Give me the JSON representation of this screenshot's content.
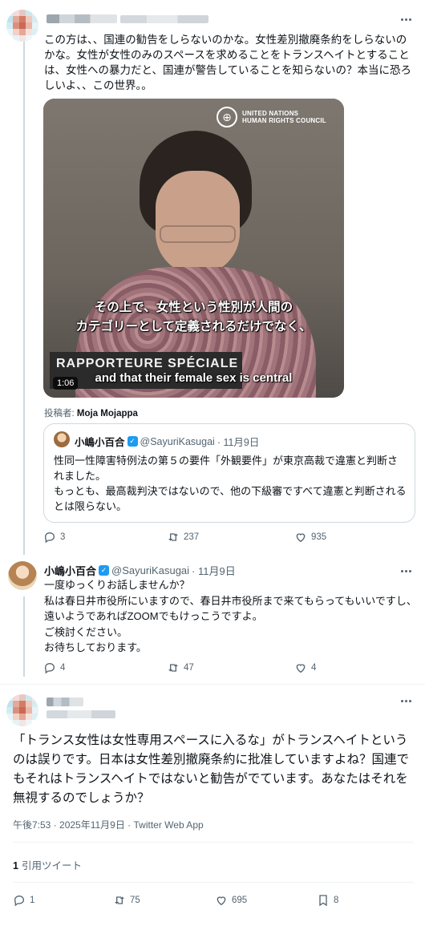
{
  "tweet1": {
    "text": "この方は、、国連の勧告をしらないのかな。女性差別撤廃条約をしらないのかな。女性が女性のみのスペースを求めることをトランスヘイトとすることは、女性への暴力だと、国連が警告していることを知らないの？本当に恐ろしいよ、、この世界。。",
    "video": {
      "logo_line1": "UNITED NATIONS",
      "logo_line2": "HUMAN RIGHTS COUNCIL",
      "subtitle_ja_1": "その上で、女性という性別が人間の",
      "subtitle_ja_2": "カテゴリーとして定義されるだけでなく、",
      "placard": "RAPPORTEURE SPÉCIALE",
      "subtitle_en": "and that their female sex is central",
      "time": "1:06"
    },
    "attribution_prefix": "投稿者: ",
    "attribution_name": "Moja Mojappa",
    "quote": {
      "name": "小嶋小百合",
      "handle": "@SayuriKasugai",
      "date": "· 11月9日",
      "text": "性同一性障害特例法の第５の要件「外観要件」が東京高裁で違憲と判断されました。\nもっとも、最高裁判決ではないので、他の下級審ですべて違憲と判断されるとは限らない。"
    },
    "stats": {
      "replies": "3",
      "retweets": "237",
      "likes": "935"
    }
  },
  "tweet2": {
    "name": "小嶋小百合",
    "handle": "@SayuriKasugai",
    "date": "· 11月9日",
    "text": "一度ゆっくりお話しませんか？\n私は春日井市役所にいますので、春日井市役所まで来てもらってもいいですし、遠いようであればZOOMでもけっこうですよ。\nご検討ください。\nお待ちしております。",
    "stats": {
      "replies": "4",
      "retweets": "47",
      "likes": "4"
    }
  },
  "tweet3": {
    "text": "「トランス女性は女性専用スペースに入るな」がトランスヘイトというのは誤りです。日本は女性差別撤廃条約に批准していますよね？国連でもそれはトランスヘイトではないと勧告がでています。あなたはそれを無視するのでしょうか？",
    "meta": "午後7:53 · 2025年11月9日 · Twitter Web App",
    "quote_count": "1",
    "quote_label": "引用ツイート",
    "stats": {
      "replies": "1",
      "retweets": "75",
      "likes": "695",
      "bookmarks": "8"
    }
  },
  "colors": {
    "accent": "#1d9bf0",
    "text": "#0f1419",
    "muted": "#536471",
    "border": "#cfd9de"
  },
  "icons": [
    "reply-icon",
    "retweet-icon",
    "like-icon",
    "bookmark-icon",
    "more-icon",
    "verified-icon"
  ]
}
